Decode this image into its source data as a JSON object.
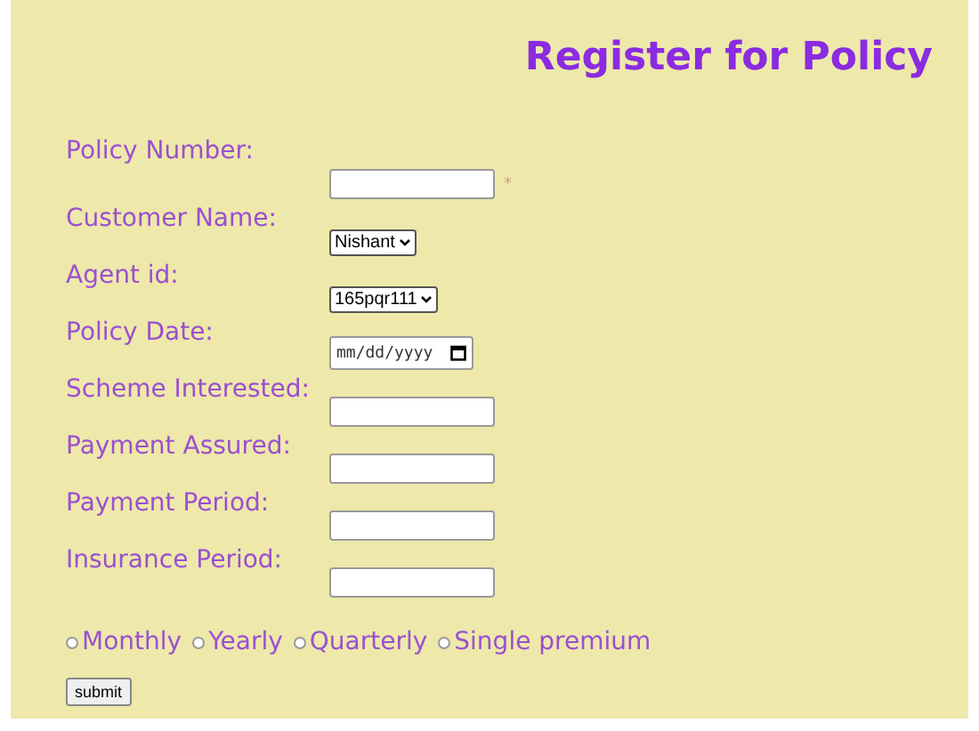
{
  "title": "Register for Policy",
  "fields": [
    {
      "label": "Policy Number:",
      "kind": "text",
      "required_mark": "*"
    },
    {
      "label": "Customer Name:",
      "kind": "select",
      "value": "Nishant"
    },
    {
      "label": "Agent id:",
      "kind": "select",
      "value": "165pqr111"
    },
    {
      "label": "Policy Date:",
      "kind": "date",
      "placeholder": "mm/dd/yyyy"
    },
    {
      "label": "Scheme Interested:",
      "kind": "text"
    },
    {
      "label": "Payment Assured:",
      "kind": "text"
    },
    {
      "label": "Payment Period:",
      "kind": "text"
    },
    {
      "label": "Insurance Period:",
      "kind": "text"
    }
  ],
  "frequency": [
    {
      "label": "Monthly",
      "selected": false
    },
    {
      "label": "Yearly",
      "selected": false
    },
    {
      "label": "Quarterly",
      "selected": false
    },
    {
      "label": "Single premium",
      "selected": false
    }
  ],
  "submit": "submit"
}
